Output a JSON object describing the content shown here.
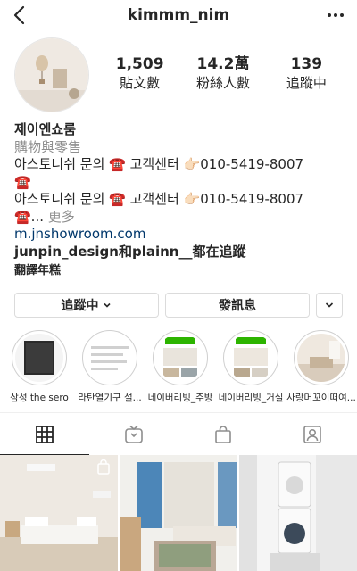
{
  "header": {
    "username": "kimmm_nim",
    "back_icon": "back-chevron-icon",
    "more_icon": "more-dots-icon"
  },
  "stats": [
    {
      "value": "1,509",
      "label": "貼文數"
    },
    {
      "value": "14.2萬",
      "label": "粉絲人數"
    },
    {
      "value": "139",
      "label": "追蹤中"
    }
  ],
  "bio": {
    "name": "제이엔쇼룸",
    "category": "購物與零售",
    "line1": "아스토니쉬 문의 ☎️ 고객센터 👉🏻010-5419-8007",
    "line1b": "☎️",
    "line2": "아스토니쉬 문의 ☎️ 고객센터 👉🏻010-5419-8007",
    "line2b": "☎️...",
    "more": "更多",
    "link": "m.jnshowroom.com",
    "followed_by": "junpin_design和plainn__都在追蹤",
    "translate": "翻譯年糕"
  },
  "buttons": {
    "following": "追蹤中",
    "message": "發訊息"
  },
  "highlights": [
    {
      "label": "삼성 the sero"
    },
    {
      "label": "라탄열기구 설..."
    },
    {
      "label": "네이버리빙_주방"
    },
    {
      "label": "네이버리빙_거실"
    },
    {
      "label": "사랑머꼬이떠여..."
    }
  ],
  "tabs": [
    "grid-icon",
    "igtv-icon",
    "shop-bag-icon",
    "tagged-icon"
  ],
  "colors": {
    "link": "#00376b",
    "secondary": "#8e8e8e",
    "border": "#dbdbdb",
    "green_banner": "#2db400"
  }
}
